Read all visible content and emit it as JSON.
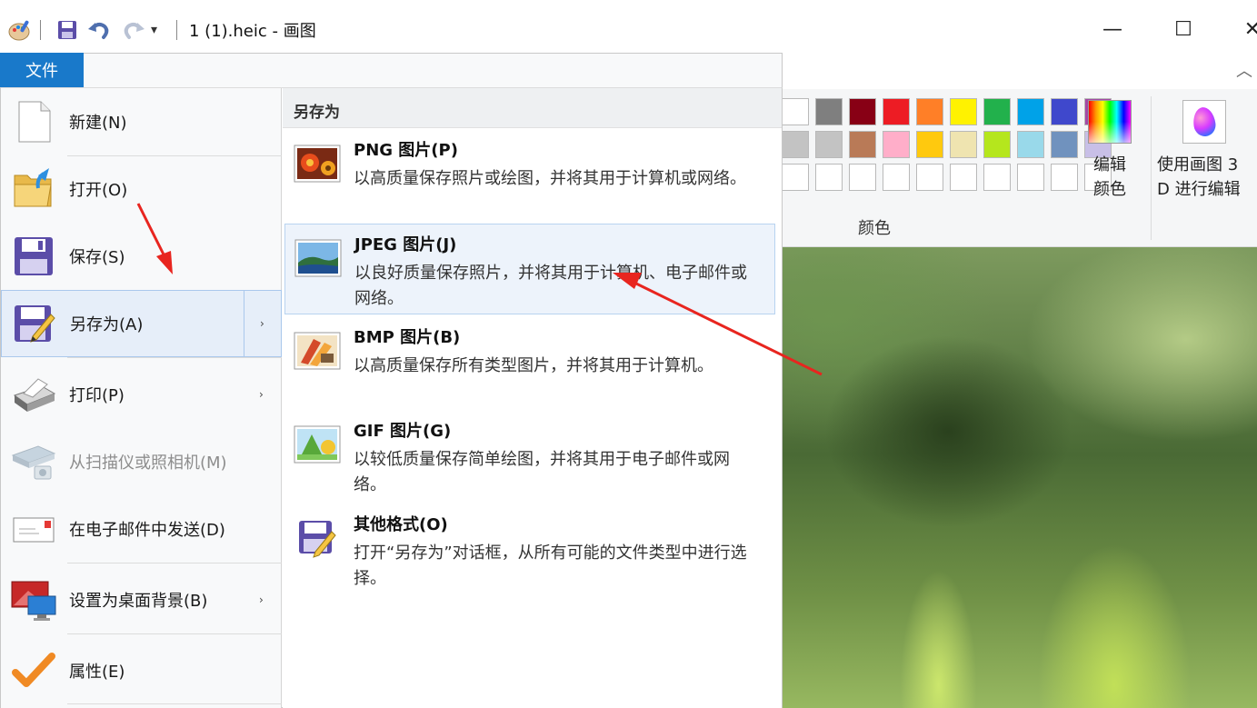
{
  "window": {
    "title": "1 (1).heic - 画图",
    "controls": {
      "minimize": "—",
      "maximize": "☐",
      "close": "✕"
    }
  },
  "ribbon": {
    "collapse": "︿",
    "palette_row1": [
      "#7f7f7f",
      "#880015",
      "#ed1c24",
      "#ff7f27",
      "#fff200",
      "#22b14c",
      "#00a2e8",
      "#3f48cc",
      "#a349a4"
    ],
    "palette_row2": [
      "#c3c3c3",
      "#b97a57",
      "#ffaec9",
      "#ffc90e",
      "#efe4b0",
      "#b5e61d",
      "#99d9ea",
      "#7092be",
      "#c8bfe7"
    ],
    "colors_label": "颜色",
    "edit_colors_label": "编辑\n颜色",
    "paint3d_label": "使用画图 3\nD 进行编辑"
  },
  "file_tab": "文件",
  "menu": {
    "items": [
      {
        "label": "新建(N)",
        "icon": "new-document-icon"
      },
      {
        "label": "打开(O)",
        "icon": "open-folder-icon"
      },
      {
        "label": "保存(S)",
        "icon": "save-icon"
      },
      {
        "label": "另存为(A)",
        "icon": "save-as-icon",
        "arrow": "›"
      },
      {
        "label": "打印(P)",
        "icon": "printer-icon",
        "arrow": "›"
      },
      {
        "label": "从扫描仪或照相机(M)",
        "icon": "scanner-icon"
      },
      {
        "label": "在电子邮件中发送(D)",
        "icon": "email-icon"
      },
      {
        "label": "设置为桌面背景(B)",
        "icon": "desktop-background-icon",
        "arrow": "›"
      },
      {
        "label": "属性(E)",
        "icon": "properties-check-icon"
      }
    ],
    "saveas": {
      "heading": "另存为",
      "options": [
        {
          "title": "PNG 图片(P)",
          "desc": "以高质量保存照片或绘图，并将其用于计算机或网络。",
          "icon": "png-image-icon"
        },
        {
          "title": "JPEG 图片(J)",
          "desc": "以良好质量保存照片，并将其用于计算机、电子邮件或网络。",
          "icon": "jpeg-image-icon"
        },
        {
          "title": "BMP 图片(B)",
          "desc": "以高质量保存所有类型图片，并将其用于计算机。",
          "icon": "bmp-image-icon"
        },
        {
          "title": "GIF 图片(G)",
          "desc": "以较低质量保存简单绘图，并将其用于电子邮件或网络。",
          "icon": "gif-image-icon"
        },
        {
          "title": "其他格式(O)",
          "desc": "打开“另存为”对话框，从所有可能的文件类型中进行选择。",
          "icon": "other-formats-icon"
        }
      ]
    }
  }
}
